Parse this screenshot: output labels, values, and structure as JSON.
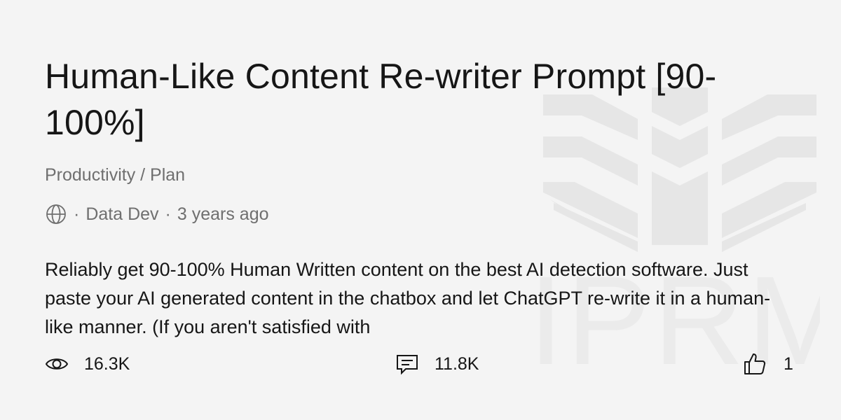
{
  "prompt": {
    "title": "Human-Like Content Re-writer Prompt [90-100%]",
    "category": "Productivity / Plan",
    "visibility_icon": "globe-icon",
    "author": "Data Dev",
    "separator": "·",
    "posted": "3 years ago",
    "description": "Reliably get 90-100% Human Written content on the best AI detection software. Just paste your AI generated content in the chatbox and let ChatGPT re-write it in a human-like manner. (If you aren't satisfied with"
  },
  "stats": {
    "views": {
      "icon": "eye-icon",
      "value": "16.3K"
    },
    "comments": {
      "icon": "comment-icon",
      "value": "11.8K"
    },
    "likes": {
      "icon": "thumbs-up-icon",
      "value": "1"
    }
  },
  "watermark": {
    "text": "AIPRM",
    "color": "#e6e6e6"
  }
}
